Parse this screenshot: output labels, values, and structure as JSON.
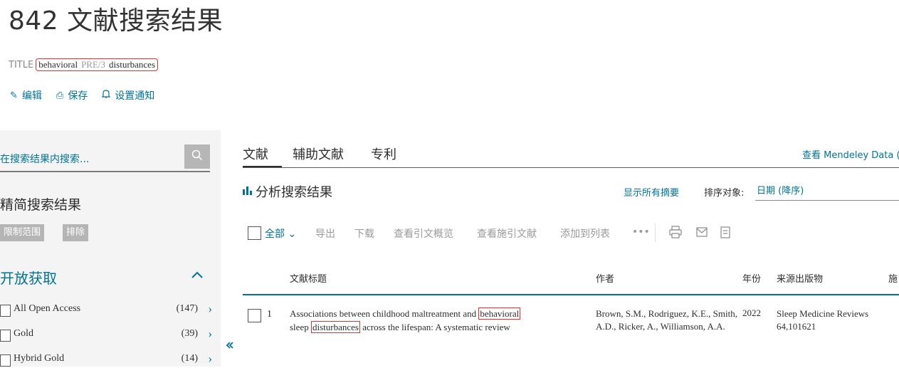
{
  "header": {
    "results_title": "842 文献搜索结果",
    "query": {
      "field": "TITLE",
      "term1": "behavioral",
      "operator": "PRE/3",
      "term2": "disturbances"
    },
    "actions": [
      {
        "icon": "pencil-icon",
        "glyph": "✎",
        "label": "编辑"
      },
      {
        "icon": "save-icon",
        "glyph": "⎙",
        "label": "保存"
      },
      {
        "icon": "bell-icon",
        "glyph": "🔔︎",
        "label": "设置通知"
      }
    ]
  },
  "sidebar": {
    "search_placeholder": "在搜索结果内搜索...",
    "refine_title": "精简搜索结果",
    "limit_button": "限制范围",
    "exclude_button": "排除",
    "open_access": {
      "title": "开放获取",
      "facets": [
        {
          "label": "All Open Access",
          "count": "(147)"
        },
        {
          "label": "Gold",
          "count": "(39)"
        },
        {
          "label": "Hybrid Gold",
          "count": "(14)"
        }
      ]
    }
  },
  "main": {
    "tabs": [
      {
        "label": "文献"
      },
      {
        "label": "辅助文献"
      },
      {
        "label": "专利"
      }
    ],
    "mendeley_link": "查看 Mendeley Data (",
    "analyze_label": "分析搜索结果",
    "show_abstracts": "显示所有摘要",
    "sort_label": "排序对象:",
    "sort_value": "日期 (降序)",
    "toolbar": {
      "all_label": "全部",
      "export": "导出",
      "download": "下载",
      "citation_overview": "查看引文概览",
      "cited_by": "查看施引文献",
      "add_to_list": "添加到列表",
      "more": "•••"
    },
    "columns": {
      "title": "文献标题",
      "authors": "作者",
      "year": "年份",
      "source": "来源出版物",
      "cited": "施"
    },
    "results": [
      {
        "num": "1",
        "title_before": "Associations between childhood maltreatment and ",
        "title_hl1": "behavioral",
        "title_mid": "sleep ",
        "title_hl2": "disturbances",
        "title_after": " across the lifespan: A systematic review",
        "authors": "Brown, S.M., Rodriguez, K.E., Smith, A.D., Ricker, A., Williamson, A.A.",
        "year": "2022",
        "source_title": "Sleep Medicine Reviews",
        "source_detail": "64,101621"
      }
    ]
  }
}
